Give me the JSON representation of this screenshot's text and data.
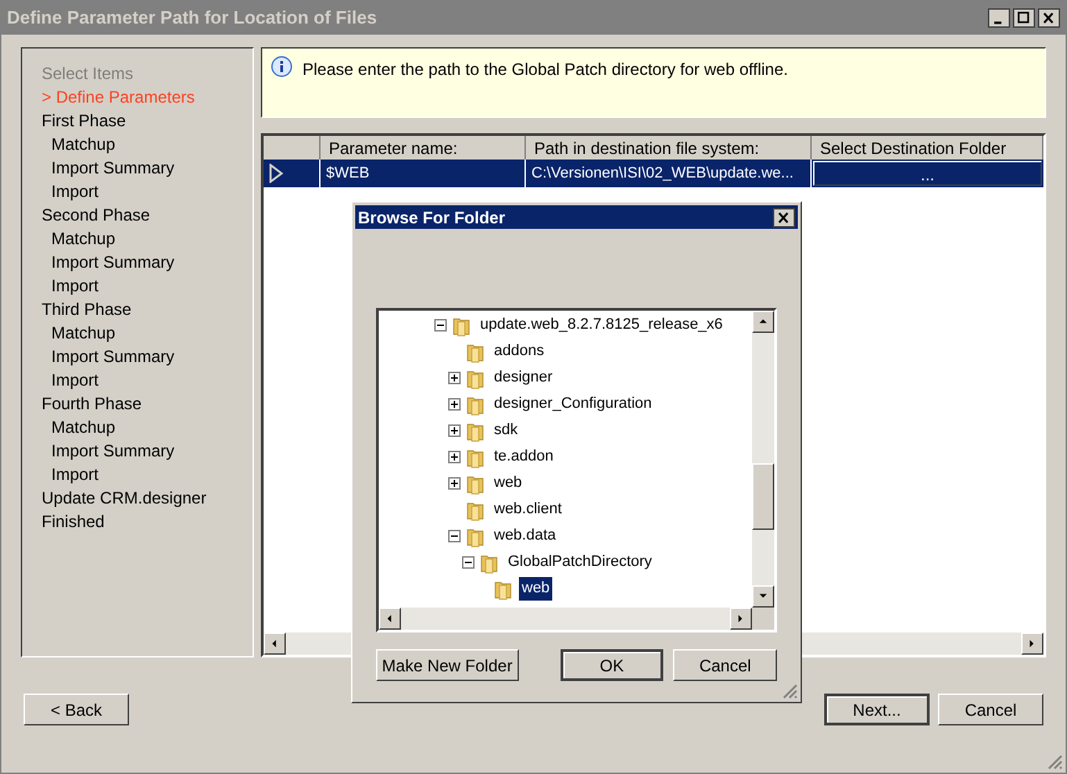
{
  "window": {
    "title": "Define Parameter Path for Location of Files"
  },
  "steps": [
    {
      "label": "Select Items",
      "disabled": true,
      "selected": false
    },
    {
      "label": "> Define Parameters",
      "disabled": false,
      "selected": true
    },
    {
      "label": "First Phase",
      "disabled": false,
      "selected": false,
      "children": [
        {
          "label": "Matchup"
        },
        {
          "label": "Import Summary"
        },
        {
          "label": "Import"
        }
      ]
    },
    {
      "label": "Second Phase",
      "disabled": false,
      "selected": false,
      "children": [
        {
          "label": "Matchup"
        },
        {
          "label": "Import Summary"
        },
        {
          "label": "Import"
        }
      ]
    },
    {
      "label": "Third Phase",
      "disabled": false,
      "selected": false,
      "children": [
        {
          "label": "Matchup"
        },
        {
          "label": "Import Summary"
        },
        {
          "label": "Import"
        }
      ]
    },
    {
      "label": "Fourth Phase",
      "disabled": false,
      "selected": false,
      "children": [
        {
          "label": "Matchup"
        },
        {
          "label": "Import Summary"
        },
        {
          "label": "Import"
        }
      ]
    },
    {
      "label": "Update CRM.designer",
      "disabled": false,
      "selected": false
    },
    {
      "label": "Finished",
      "disabled": false,
      "selected": false
    }
  ],
  "info": {
    "message": "Please enter the path to the Global Patch directory for web offline."
  },
  "table": {
    "columns": [
      "Parameter name:",
      "Path in destination file system:",
      "Select Destination Folder"
    ],
    "rows": [
      {
        "selected": true,
        "cells": [
          "$WEB",
          "C:\\Versionen\\ISI\\02_WEB\\update.we...",
          "..."
        ]
      }
    ]
  },
  "dialog": {
    "title": "Browse For Folder",
    "tree": [
      {
        "label": "update.web_8.2.7.8125_release_x6",
        "expandable": true,
        "expanded": true,
        "selected": false,
        "children": [
          {
            "label": "addons",
            "expandable": false,
            "selected": false
          },
          {
            "label": "designer",
            "expandable": true,
            "expanded": false,
            "selected": false
          },
          {
            "label": "designer_Configuration",
            "expandable": true,
            "expanded": false,
            "selected": false
          },
          {
            "label": "sdk",
            "expandable": true,
            "expanded": false,
            "selected": false
          },
          {
            "label": "te.addon",
            "expandable": true,
            "expanded": false,
            "selected": false
          },
          {
            "label": "web",
            "expandable": true,
            "expanded": false,
            "selected": false
          },
          {
            "label": "web.client",
            "expandable": false,
            "selected": false
          },
          {
            "label": "web.data",
            "expandable": true,
            "expanded": true,
            "selected": false,
            "children": [
              {
                "label": "GlobalPatchDirectory",
                "expandable": true,
                "expanded": true,
                "selected": false,
                "children": [
                  {
                    "label": "web",
                    "expandable": false,
                    "selected": true
                  }
                ]
              }
            ]
          }
        ]
      }
    ],
    "buttons": [
      {
        "label": "Make New Folder",
        "default": false
      },
      {
        "label": "OK",
        "default": true
      },
      {
        "label": "Cancel",
        "default": false
      }
    ]
  },
  "buttons": [
    {
      "label": "< Back",
      "default": false
    },
    {
      "label": "Next...",
      "default": true
    },
    {
      "label": "Cancel",
      "default": false
    }
  ]
}
